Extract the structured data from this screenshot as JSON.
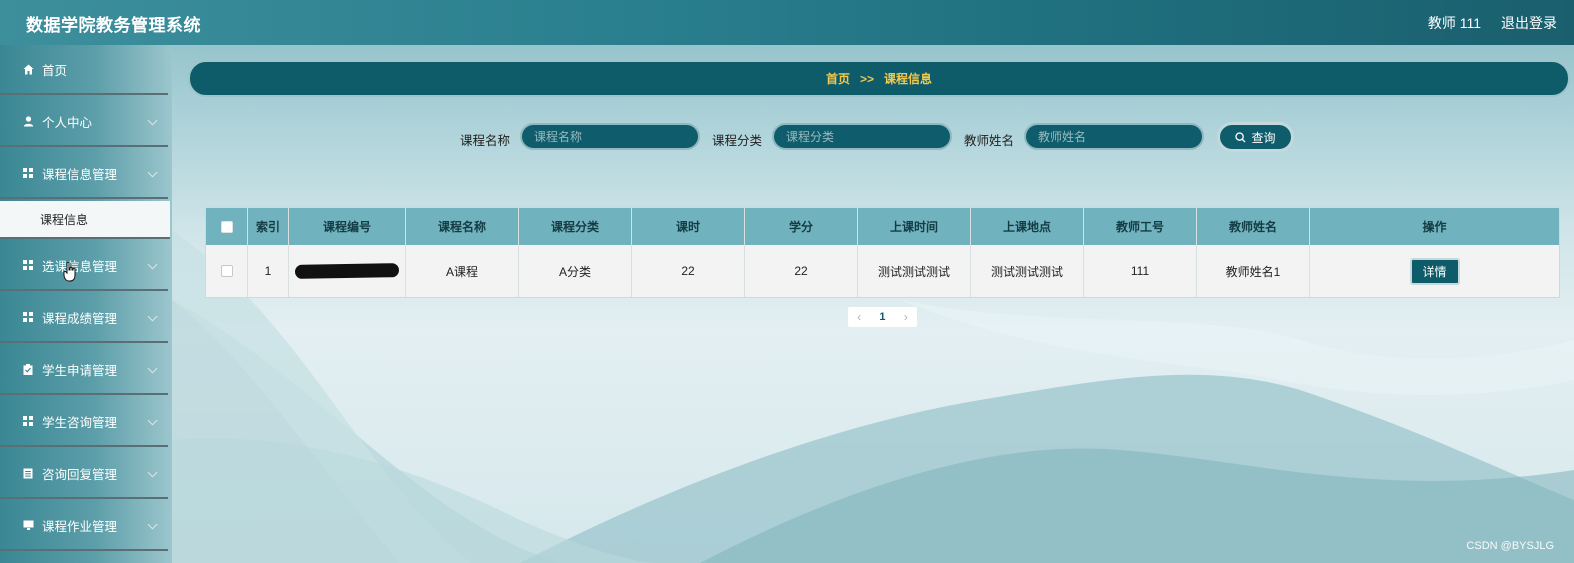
{
  "header": {
    "app_title": "数据学院教务管理系统",
    "user_label": "教师 111",
    "logout_label": "退出登录"
  },
  "sidebar": {
    "items": [
      {
        "label": "首页",
        "icon": "home-icon",
        "has_chevron": false
      },
      {
        "label": "个人中心",
        "icon": "user-icon",
        "has_chevron": true
      },
      {
        "label": "课程信息管理",
        "icon": "grid-icon",
        "has_chevron": true
      },
      {
        "label": "选课信息管理",
        "icon": "grid-icon",
        "has_chevron": true
      },
      {
        "label": "课程成绩管理",
        "icon": "grid-icon",
        "has_chevron": true
      },
      {
        "label": "学生申请管理",
        "icon": "clipboard-icon",
        "has_chevron": true
      },
      {
        "label": "学生咨询管理",
        "icon": "grid-icon",
        "has_chevron": true
      },
      {
        "label": "咨询回复管理",
        "icon": "document-icon",
        "has_chevron": true
      },
      {
        "label": "课程作业管理",
        "icon": "monitor-icon",
        "has_chevron": true
      }
    ],
    "active_sub_item": "课程信息"
  },
  "breadcrumb": {
    "home": "首页",
    "separator": ">>",
    "current": "课程信息"
  },
  "search": {
    "course_name_label": "课程名称",
    "course_name_placeholder": "课程名称",
    "course_category_label": "课程分类",
    "course_category_placeholder": "课程分类",
    "teacher_name_label": "教师姓名",
    "teacher_name_placeholder": "教师姓名",
    "query_button": "查询"
  },
  "table": {
    "columns": [
      "索引",
      "课程编号",
      "课程名称",
      "课程分类",
      "课时",
      "学分",
      "上课时间",
      "上课地点",
      "教师工号",
      "教师姓名",
      "操作"
    ],
    "rows": [
      {
        "index": "1",
        "course_code": "",
        "course_name": "A课程",
        "course_category": "A分类",
        "hours": "22",
        "credits": "22",
        "class_time": "测试测试测试",
        "class_location": "测试测试测试",
        "teacher_id": "111",
        "teacher_name": "教师姓名1",
        "action": "详情"
      }
    ]
  },
  "pagination": {
    "current_page": "1",
    "prev": "‹",
    "next": "›"
  },
  "watermark": "CSDN @BYSJLG",
  "colors": {
    "header_bg": "#1f6f7e",
    "accent_dark": "#0e5b6a",
    "table_header": "#70b2bd",
    "breadcrumb_text": "#f2c94c"
  }
}
